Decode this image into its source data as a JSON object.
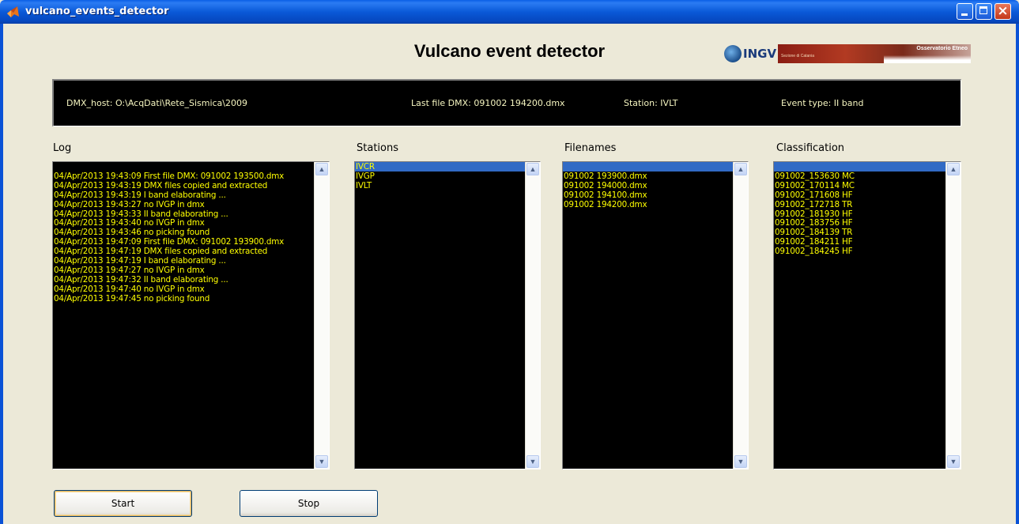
{
  "window": {
    "title": "vulcano_events_detector"
  },
  "app": {
    "heading": "Vulcano event detector"
  },
  "logo": {
    "text": "INGV",
    "subtitle": "Osservatorio Etneo",
    "tagline": "Sezione di Catania"
  },
  "status": {
    "dmx_host": "DMX_host: O:\\AcqDati\\Rete_Sismica\\2009",
    "last_file": "Last file DMX: 091002 194200.dmx",
    "station": "Station: IVLT",
    "event_type": "Event type: II band"
  },
  "panels": {
    "log": {
      "label": "Log",
      "items": [
        "",
        "04/Apr/2013 19:43:09 First file DMX: 091002 193500.dmx",
        "04/Apr/2013 19:43:19 DMX files copied and extracted",
        "04/Apr/2013 19:43:19 I band elaborating ...",
        "04/Apr/2013 19:43:27  no IVGP in dmx",
        "04/Apr/2013 19:43:33 II band elaborating ...",
        "04/Apr/2013 19:43:40  no IVGP in dmx",
        "04/Apr/2013 19:43:46 no picking found",
        "04/Apr/2013 19:47:09 First file DMX: 091002 193900.dmx",
        "04/Apr/2013 19:47:19 DMX files copied and extracted",
        "04/Apr/2013 19:47:19 I band elaborating ...",
        "04/Apr/2013 19:47:27  no IVGP in dmx",
        "04/Apr/2013 19:47:32 II band elaborating ...",
        "04/Apr/2013 19:47:40  no IVGP in dmx",
        "04/Apr/2013 19:47:45 no picking found"
      ],
      "selected_index": null
    },
    "stations": {
      "label": "Stations",
      "items": [
        "IVCR",
        "IVGP",
        "IVLT"
      ],
      "selected_index": 0
    },
    "filenames": {
      "label": "Filenames",
      "items": [
        "",
        "091002 193900.dmx",
        "091002 194000.dmx",
        "091002 194100.dmx",
        "091002 194200.dmx"
      ],
      "selected_index": 0
    },
    "classification": {
      "label": "Classification",
      "items": [
        "",
        "091002_153630 MC",
        "091002_170114 MC",
        "091002_171608 HF",
        "091002_172718 TR",
        "091002_181930 HF",
        "091002_183756 HF",
        "091002_184139 TR",
        "091002_184211 HF",
        "091002_184245 HF"
      ],
      "selected_index": 0
    }
  },
  "buttons": {
    "start": "Start",
    "stop": "Stop"
  },
  "colors": {
    "list_bg": "#000000",
    "list_text": "#ffff00",
    "selection": "#316ac5",
    "titlebar": "#0a59d8"
  },
  "icons": {
    "app": "matlab-icon",
    "scroll_up": "up-arrow-icon",
    "scroll_down": "down-arrow-icon"
  }
}
